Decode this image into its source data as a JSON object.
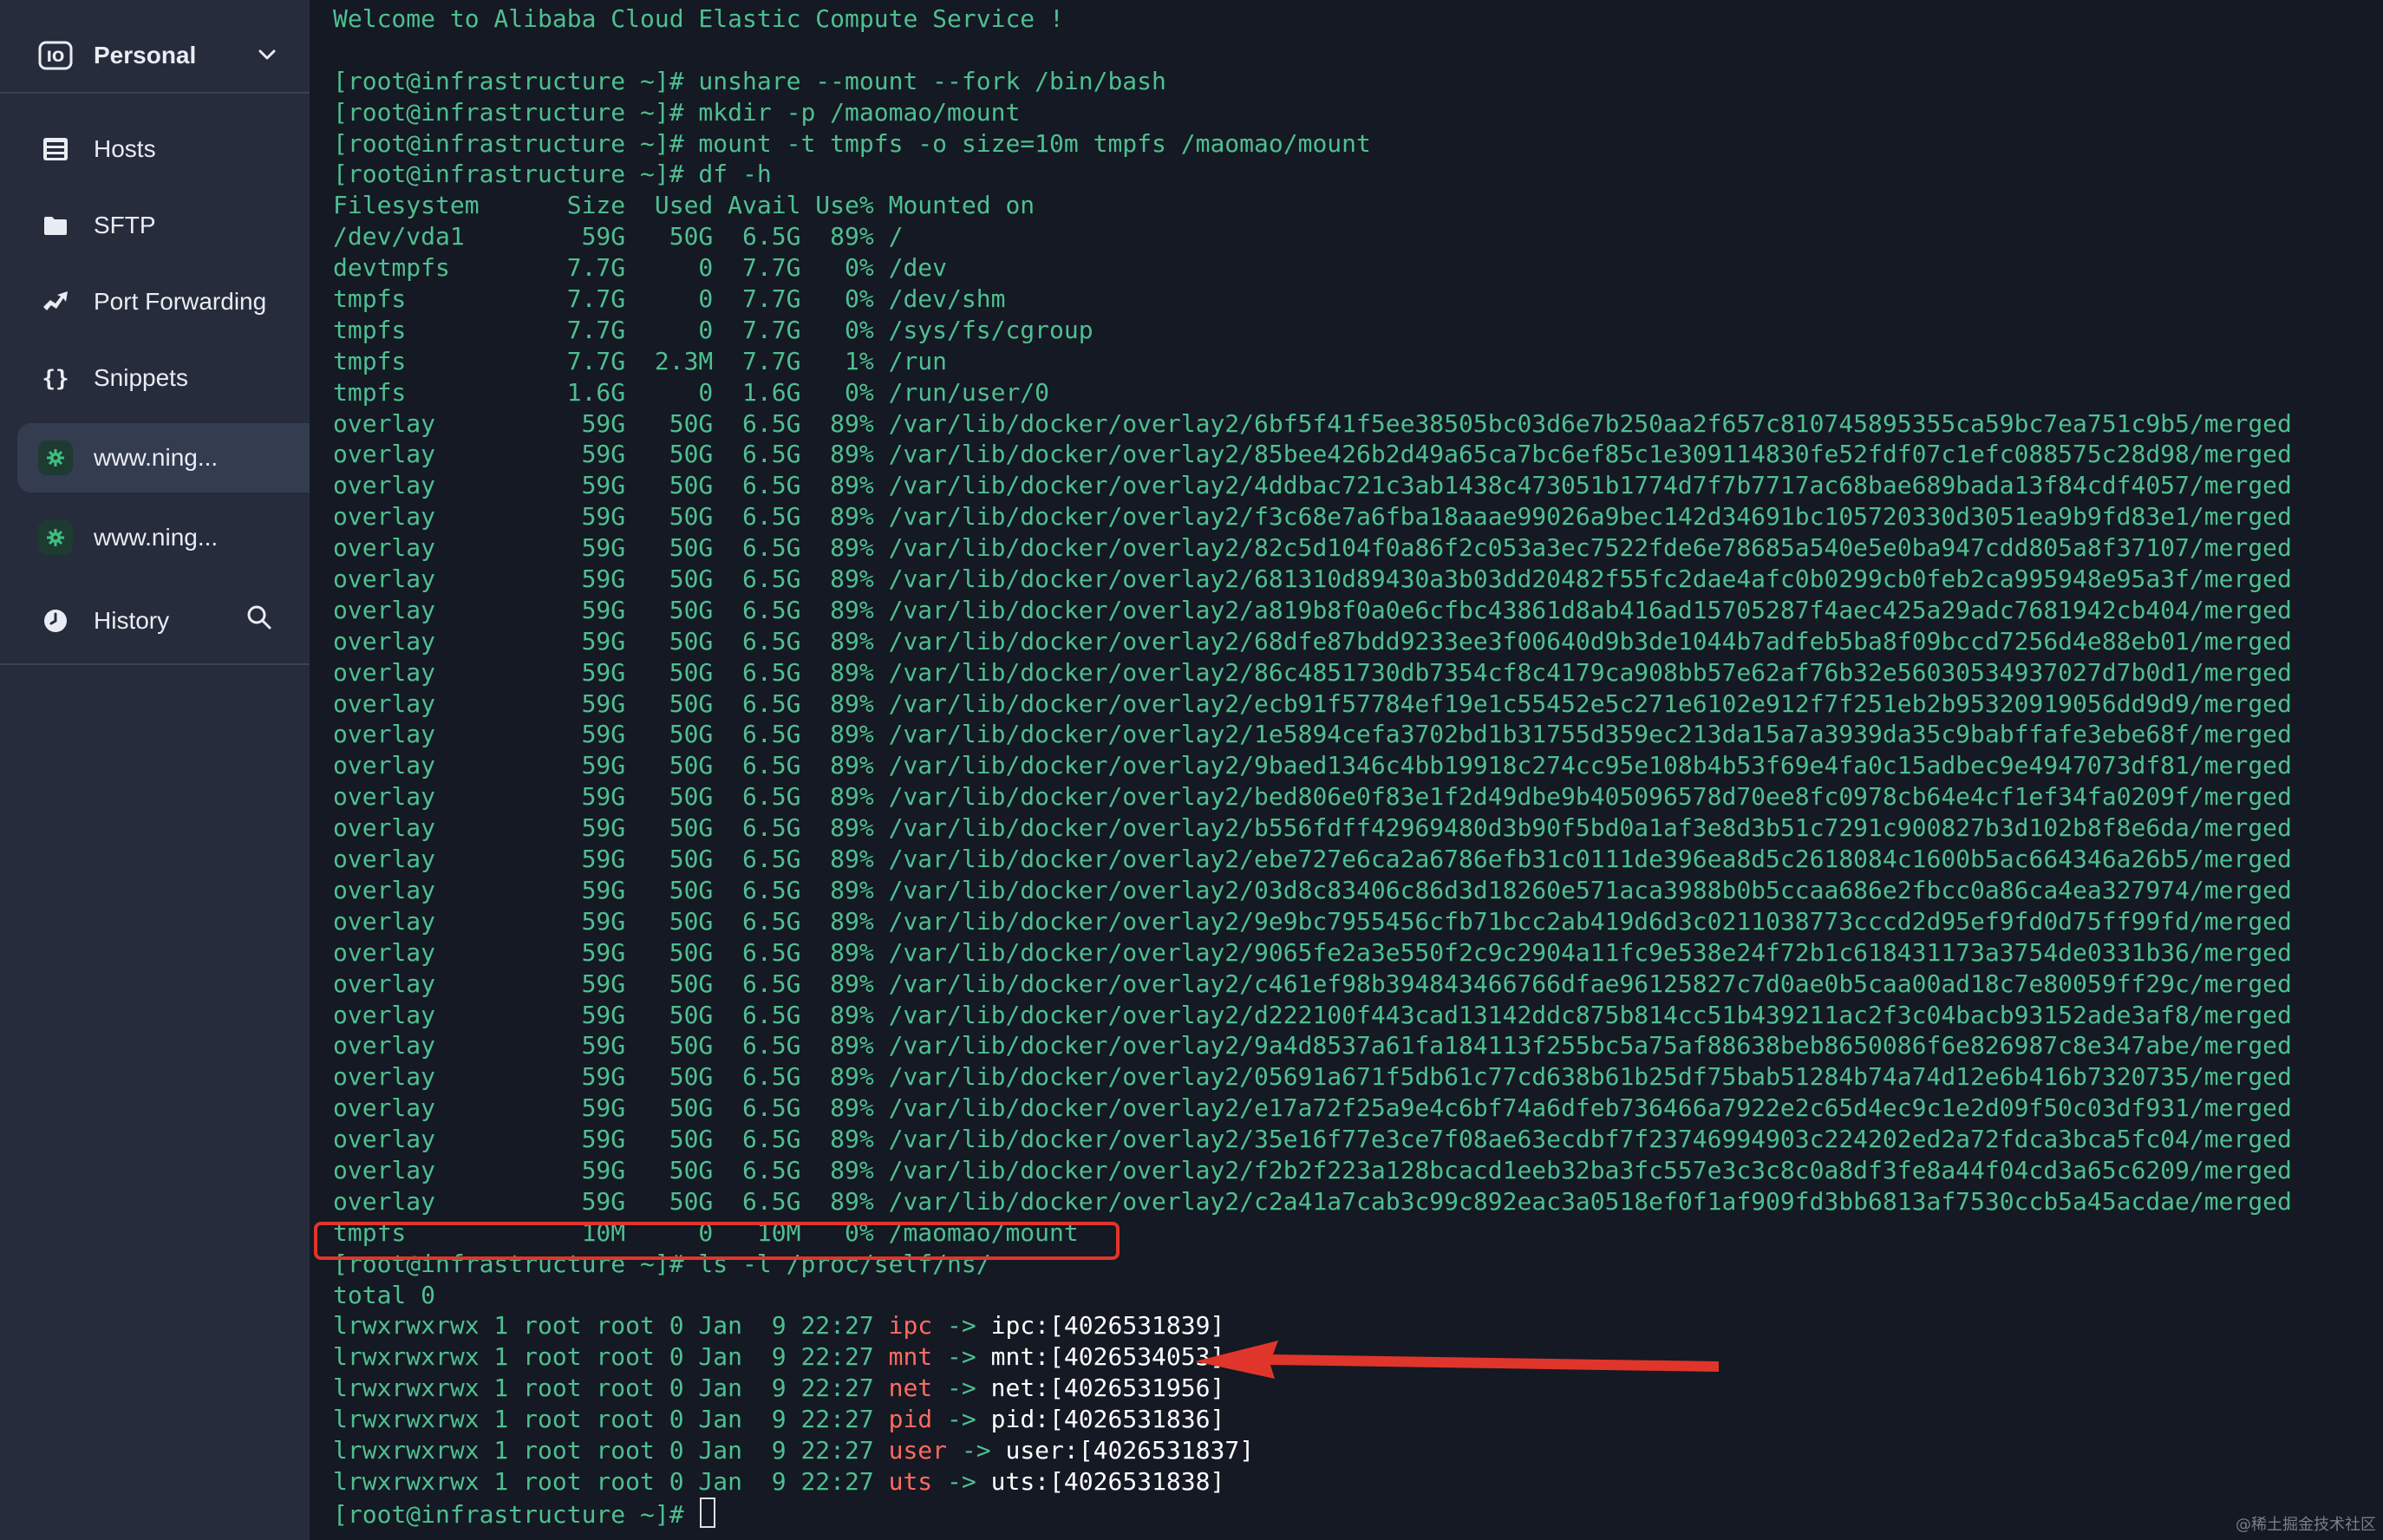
{
  "sidebar": {
    "workspace": {
      "label": "Personal"
    },
    "nav": [
      {
        "label": "Hosts",
        "icon": "hosts-icon"
      },
      {
        "label": "SFTP",
        "icon": "folder-icon"
      },
      {
        "label": "Port Forwarding",
        "icon": "port-forwarding-icon"
      },
      {
        "label": "Snippets",
        "icon": "braces-icon"
      }
    ],
    "tabs": [
      {
        "label": "www.ning...",
        "icon": "host-gear-icon"
      },
      {
        "label": "www.ning...",
        "icon": "host-gear-icon"
      }
    ],
    "history": {
      "label": "History",
      "icon": "clock-icon"
    }
  },
  "terminal": {
    "lines": [
      "Welcome to Alibaba Cloud Elastic Compute Service !",
      "",
      "[root@infrastructure ~]# unshare --mount --fork /bin/bash",
      "[root@infrastructure ~]# mkdir -p /maomao/mount",
      "[root@infrastructure ~]# mount -t tmpfs -o size=10m tmpfs /maomao/mount",
      "[root@infrastructure ~]# df -h",
      "Filesystem      Size  Used Avail Use% Mounted on",
      "/dev/vda1        59G   50G  6.5G  89% /",
      "devtmpfs        7.7G     0  7.7G   0% /dev",
      "tmpfs           7.7G     0  7.7G   0% /dev/shm",
      "tmpfs           7.7G     0  7.7G   0% /sys/fs/cgroup",
      "tmpfs           7.7G  2.3M  7.7G   1% /run",
      "tmpfs           1.6G     0  1.6G   0% /run/user/0",
      "overlay          59G   50G  6.5G  89% /var/lib/docker/overlay2/6bf5f41f5ee38505bc03d6e7b250aa2f657c810745895355ca59bc7ea751c9b5/merged",
      "overlay          59G   50G  6.5G  89% /var/lib/docker/overlay2/85bee426b2d49a65ca7bc6ef85c1e309114830fe52fdf07c1efc088575c28d98/merged",
      "overlay          59G   50G  6.5G  89% /var/lib/docker/overlay2/4ddbac721c3ab1438c473051b1774d7f7b7717ac68bae689bada13f84cdf4057/merged",
      "overlay          59G   50G  6.5G  89% /var/lib/docker/overlay2/f3c68e7a6fba18aaae99026a9bec142d34691bc105720330d3051ea9b9fd83e1/merged",
      "overlay          59G   50G  6.5G  89% /var/lib/docker/overlay2/82c5d104f0a86f2c053a3ec7522fde6e78685a540e5e0ba947cdd805a8f37107/merged",
      "overlay          59G   50G  6.5G  89% /var/lib/docker/overlay2/681310d89430a3b03dd20482f55fc2dae4afc0b0299cb0feb2ca995948e95a3f/merged",
      "overlay          59G   50G  6.5G  89% /var/lib/docker/overlay2/a819b8f0a0e6cfbc43861d8ab416ad15705287f4aec425a29adc7681942cb404/merged",
      "overlay          59G   50G  6.5G  89% /var/lib/docker/overlay2/68dfe87bdd9233ee3f00640d9b3de1044b7adfeb5ba8f09bccd7256d4e88eb01/merged",
      "overlay          59G   50G  6.5G  89% /var/lib/docker/overlay2/86c4851730db7354cf8c4179ca908bb57e62af76b32e56030534937027d7b0d1/merged",
      "overlay          59G   50G  6.5G  89% /var/lib/docker/overlay2/ecb91f57784ef19e1c55452e5c271e6102e912f7f251eb2b95320919056dd9d9/merged",
      "overlay          59G   50G  6.5G  89% /var/lib/docker/overlay2/1e5894cefa3702bd1b31755d359ec213da15a7a3939da35c9babffafe3ebe68f/merged",
      "overlay          59G   50G  6.5G  89% /var/lib/docker/overlay2/9baed1346c4bb19918c274cc95e108b4b53f69e4fa0c15adbec9e4947073df81/merged",
      "overlay          59G   50G  6.5G  89% /var/lib/docker/overlay2/bed806e0f83e1f2d49dbe9b405096578d70ee8fc0978cb64e4cf1ef34fa0209f/merged",
      "overlay          59G   50G  6.5G  89% /var/lib/docker/overlay2/b556fdff42969480d3b90f5bd0a1af3e8d3b51c7291c900827b3d102b8f8e6da/merged",
      "overlay          59G   50G  6.5G  89% /var/lib/docker/overlay2/ebe727e6ca2a6786efb31c0111de396ea8d5c2618084c1600b5ac664346a26b5/merged",
      "overlay          59G   50G  6.5G  89% /var/lib/docker/overlay2/03d8c83406c86d3d18260e571aca3988b0b5ccaa686e2fbcc0a86ca4ea327974/merged",
      "overlay          59G   50G  6.5G  89% /var/lib/docker/overlay2/9e9bc7955456cfb71bcc2ab419d6d3c0211038773cccd2d95ef9fd0d75ff99fd/merged",
      "overlay          59G   50G  6.5G  89% /var/lib/docker/overlay2/9065fe2a3e550f2c9c2904a11fc9e538e24f72b1c618431173a3754de0331b36/merged",
      "overlay          59G   50G  6.5G  89% /var/lib/docker/overlay2/c461ef98b394843466766dfae96125827c7d0ae0b5caa00ad18c7e80059ff29c/merged",
      "overlay          59G   50G  6.5G  89% /var/lib/docker/overlay2/d222100f443cad13142ddc875b814cc51b439211ac2f3c04bacb93152ade3af8/merged",
      "overlay          59G   50G  6.5G  89% /var/lib/docker/overlay2/9a4d8537a61fa184113f255bc5a75af88638beb8650086f6e826987c8e347abe/merged",
      "overlay          59G   50G  6.5G  89% /var/lib/docker/overlay2/05691a671f5db61c77cd638b61b25df75bab51284b74a74d12e6b416b7320735/merged",
      "overlay          59G   50G  6.5G  89% /var/lib/docker/overlay2/e17a72f25a9e4c6bf74a6dfeb736466a7922e2c65d4ec9c1e2d09f50c03df931/merged",
      "overlay          59G   50G  6.5G  89% /var/lib/docker/overlay2/35e16f77e3ce7f08ae63ecdbf7f23746994903c224202ed2a72fdca3bca5fc04/merged",
      "overlay          59G   50G  6.5G  89% /var/lib/docker/overlay2/f2b2f223a128bcacd1eeb32ba3fc557e3c3c8c0a8df3fe8a44f04cd3a65c6209/merged",
      "overlay          59G   50G  6.5G  89% /var/lib/docker/overlay2/c2a41a7cab3c99c892eac3a0518ef0f1af909fd3bb6813af7530ccb5a45acdae/merged",
      "tmpfs            10M     0   10M   0% /maomao/mount",
      "[root@infrastructure ~]# ls -l /proc/self/ns/",
      "total 0"
    ],
    "ns_entries": [
      {
        "prefix": "lrwxrwxrwx 1 root root 0 Jan  9 22:27 ",
        "name": "ipc",
        "arrow": " -> ",
        "target": "ipc:[4026531839]"
      },
      {
        "prefix": "lrwxrwxrwx 1 root root 0 Jan  9 22:27 ",
        "name": "mnt",
        "arrow": " -> ",
        "target": "mnt:[4026534053]"
      },
      {
        "prefix": "lrwxrwxrwx 1 root root 0 Jan  9 22:27 ",
        "name": "net",
        "arrow": " -> ",
        "target": "net:[4026531956]"
      },
      {
        "prefix": "lrwxrwxrwx 1 root root 0 Jan  9 22:27 ",
        "name": "pid",
        "arrow": " -> ",
        "target": "pid:[4026531836]"
      },
      {
        "prefix": "lrwxrwxrwx 1 root root 0 Jan  9 22:27 ",
        "name": "user",
        "arrow": " -> ",
        "target": "user:[4026531837]"
      },
      {
        "prefix": "lrwxrwxrwx 1 root root 0 Jan  9 22:27 ",
        "name": "uts",
        "arrow": " -> ",
        "target": "uts:[4026531838]"
      }
    ],
    "prompt": "[root@infrastructure ~]# "
  },
  "watermark": "@稀土掘金技术社区",
  "colors": {
    "sidebar_bg": "#262c3b",
    "terminal_bg": "#141924",
    "terminal_text": "#4fbf8f",
    "ns_name": "#ff6b5e",
    "annotation": "#e0352b"
  }
}
